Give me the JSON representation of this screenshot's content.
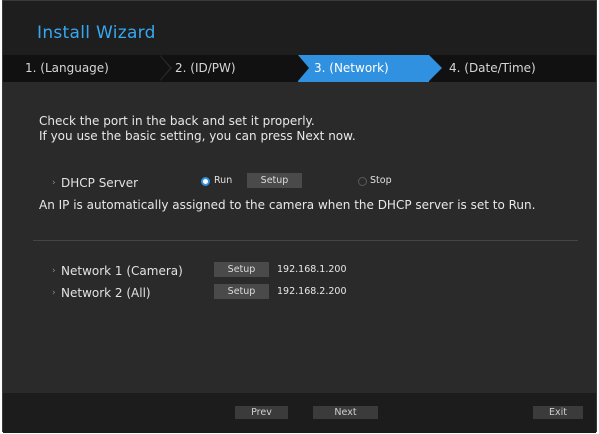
{
  "window": {
    "title": "Install Wizard"
  },
  "steps": [
    {
      "label": "1.  (Language)"
    },
    {
      "label": "2.  (ID/PW)"
    },
    {
      "label": "3.  (Network)"
    },
    {
      "label": "4.  (Date/Time)"
    }
  ],
  "active_step": 3,
  "intro": {
    "line1": "Check the port in the back and set it properly.",
    "line2": "If you use the basic setting, you can press Next now."
  },
  "dhcp": {
    "label": "DHCP Server",
    "options": [
      {
        "label": "Run",
        "selected": true
      },
      {
        "label": "Stop",
        "selected": false
      }
    ],
    "setup_label": "Setup",
    "info": "An IP is automatically assigned to the camera when the DHCP server is set to Run."
  },
  "networks": [
    {
      "label": "Network 1 (Camera)",
      "setup_label": "Setup",
      "ip": "192.168.1.200"
    },
    {
      "label": "Network 2 (All)",
      "setup_label": "Setup",
      "ip": "192.168.2.200"
    }
  ],
  "footer": {
    "prev_label": "Prev",
    "next_label": "Next",
    "exit_label": "Exit"
  },
  "colors": {
    "accent": "#2f91e0",
    "title": "#36a8f0",
    "background": "#2a2a2a"
  },
  "icons": {
    "bullet": "bullet-icon",
    "radio_on": "radio-selected-icon",
    "radio_off": "radio-unselected-icon"
  }
}
